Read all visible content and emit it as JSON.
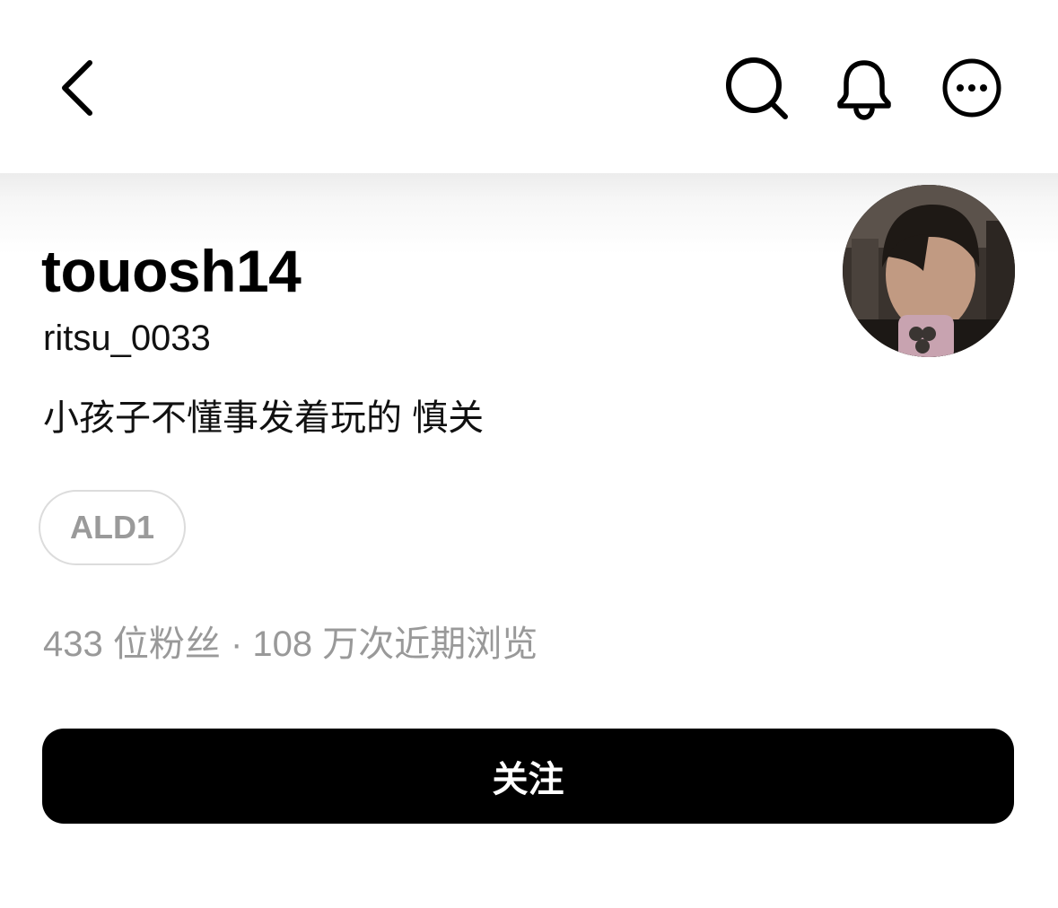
{
  "nav": {
    "back_icon": "chevron-left-icon",
    "search_icon": "search-icon",
    "bell_icon": "bell-icon",
    "more_icon": "more-horizontal-icon"
  },
  "profile": {
    "display_name": "touosh14",
    "handle": "ritsu_0033",
    "bio": "小孩子不懂事发着玩的 慎关",
    "tag": "ALD1",
    "stats": "433 位粉丝 · 108 万次近期浏览",
    "avatar": "profile-photo"
  },
  "actions": {
    "follow_label": "关注"
  },
  "colors": {
    "background": "#ffffff",
    "primary_button": "#000000",
    "muted_text": "#999999",
    "chip_border": "#dcdcdc"
  }
}
